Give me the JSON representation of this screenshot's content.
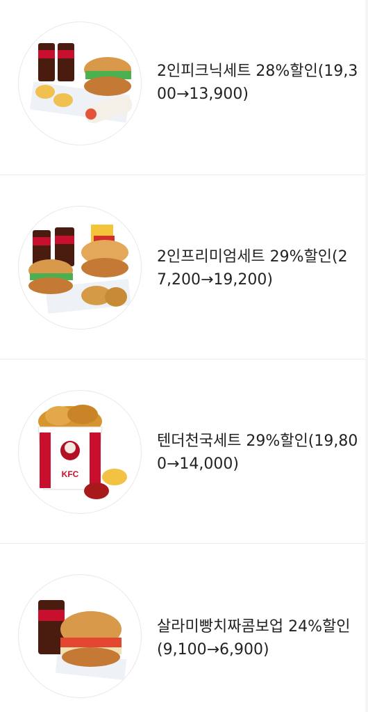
{
  "items": [
    {
      "title": "2인피크닉세트 28%할인(19,300→13,900)",
      "image": "picnic-set-image"
    },
    {
      "title": "2인프리미엄세트 29%할인(27,200→19,200)",
      "image": "premium-set-image"
    },
    {
      "title": "텐더천국세트 29%할인(19,800→14,000)",
      "image": "tender-set-image"
    },
    {
      "title": "살라미빵치짜콤보업 24%할인(9,100→6,900)",
      "image": "salami-combo-image"
    }
  ]
}
